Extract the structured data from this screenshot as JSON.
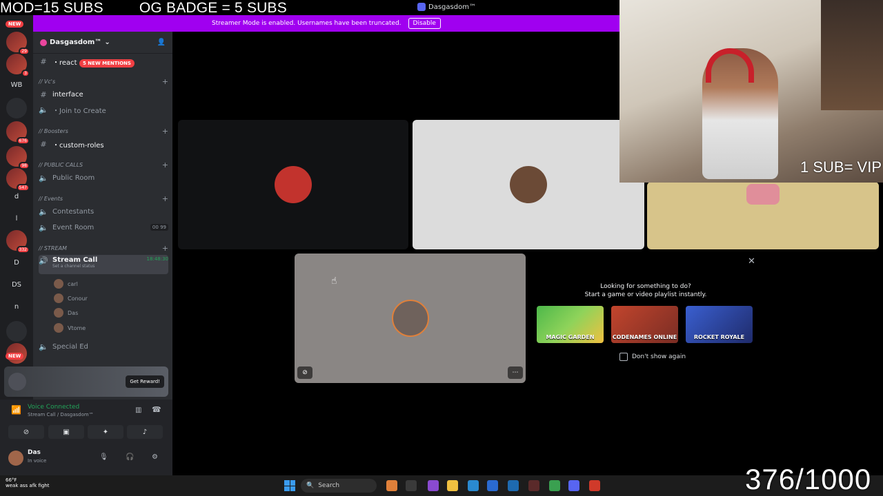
{
  "overlay": {
    "mod_text": "MOD=15 SUBS",
    "og_text": "OG BADGE = 5 SUBS",
    "vip_text": "1 SUB= VIP",
    "counter": "376/1000"
  },
  "app": {
    "title": "Dasgasdom™"
  },
  "banner": {
    "message": "Streamer Mode is enabled. Usernames have been truncated.",
    "button": "Disable"
  },
  "rail": {
    "new_top": "NEW",
    "new_bottom": "NEW",
    "items": [
      "WB",
      "d",
      "l",
      "D",
      "DS",
      "n"
    ],
    "badges": [
      "29",
      "3",
      "676",
      "98",
      "547",
      "332",
      "1"
    ]
  },
  "server": {
    "name": "Dasgasdom™"
  },
  "mention_pill": "5 NEW MENTIONS",
  "channels": {
    "reactions": "・react",
    "cat_vcs": "// Vc's",
    "interface": "interface",
    "join_create": "・Join to Create",
    "cat_boosters": "// Boosters",
    "custom_roles": "・custom-roles",
    "cat_public": "// PUBLIC CALLS",
    "public_room": "Public Room",
    "cat_events": "// Events",
    "contestants": "Contestants",
    "event_room": "Event Room",
    "event_counts": [
      "00",
      "99"
    ],
    "cat_stream": "// STREAM",
    "stream_call": "Stream Call",
    "stream_timer": "18:48:30",
    "set_status": "Set a channel status",
    "special_ed": "Special Ed"
  },
  "voice_users": [
    "carl",
    "Conour",
    "Das",
    "Vtome"
  ],
  "reward": {
    "button": "Get Reward!"
  },
  "voice_panel": {
    "status": "Voice Connected",
    "location": "Stream Call / Dasgasdom™"
  },
  "user": {
    "name": "Das",
    "status": "In voice"
  },
  "activity": {
    "line1": "Looking for something to do?",
    "line2": "Start a game or video playlist instantly.",
    "games": [
      "MAGIC GARDEN",
      "CODENAMES ONLINE",
      "ROCKET ROYALE"
    ],
    "dont_show": "Don't show again"
  },
  "taskbar": {
    "temp": "66°F",
    "weather_text": "weak ass afk fight",
    "search": "Search"
  },
  "colors": {
    "banner": "#a000f0",
    "mention": "#f23f43",
    "voice_green": "#23a55a"
  }
}
